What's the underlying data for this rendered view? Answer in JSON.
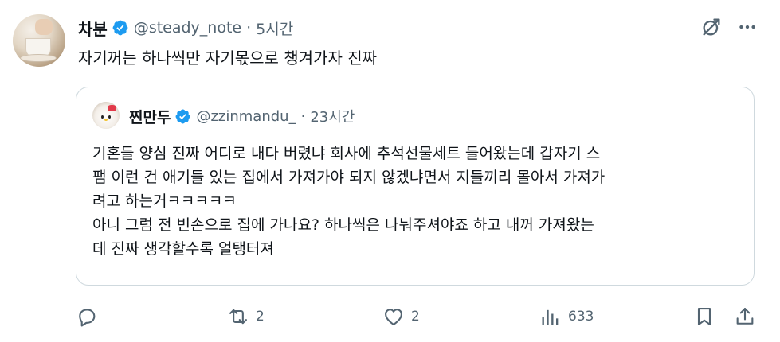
{
  "author": {
    "name": "차분",
    "handle": "@steady_note",
    "separator": "·",
    "time": "5시간",
    "verified": true,
    "avatar_icon": "avatar-teacup-photo"
  },
  "tweet": {
    "text": "자기꺼는 하나씩만 자기몫으로 챙겨가자 진짜"
  },
  "top_actions": {
    "grok_icon": "grok-icon",
    "more_icon": "more-icon",
    "more_label": "···"
  },
  "quote": {
    "name": "찐만두",
    "handle": "@zzinmandu_",
    "separator": "·",
    "time": "23시간",
    "verified": true,
    "lines": [
      "기혼들 양심 진짜 어디로 내다 버렸냐 회사에 추석선물세트 들어왔는데 갑자기 스",
      "팸 이런 건 애기들 있는 집에서 가져가야 되지 않겠냐면서 지들끼리 몰아서 가져가",
      "려고 하는거ㅋㅋㅋㅋㅋ",
      "아니 그럼 전 빈손으로 집에 가나요? 하나씩은 나눠주셔야죠 하고 내꺼 가져왔는",
      "데 진짜 생각할수록 얼탱터져"
    ]
  },
  "actions": {
    "reply": {
      "icon": "reply-icon",
      "count": ""
    },
    "repost": {
      "icon": "repost-icon",
      "count": "2"
    },
    "like": {
      "icon": "like-icon",
      "count": "2"
    },
    "views": {
      "icon": "views-icon",
      "count": "633"
    },
    "bookmark": {
      "icon": "bookmark-icon"
    },
    "share": {
      "icon": "share-icon"
    }
  },
  "colors": {
    "text": "#0f1419",
    "secondary": "#536471",
    "verified": "#1d9bf0",
    "border": "#cfd9de"
  }
}
